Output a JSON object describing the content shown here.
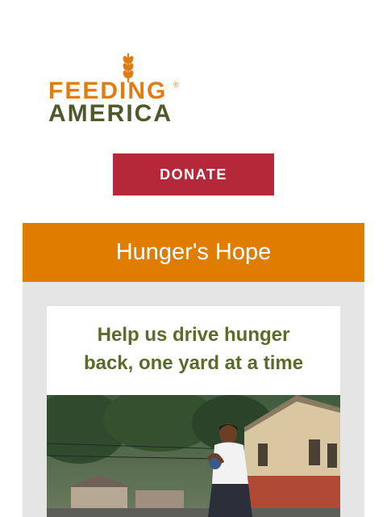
{
  "logo": {
    "line1": "FEEDING",
    "line2": "AMERICA",
    "registered_mark": "®",
    "colors": {
      "orange": "#e17c12",
      "olive": "#4c5a2a"
    }
  },
  "donate": {
    "label": "DONATE",
    "color": "#b5283a"
  },
  "banner": {
    "title": "Hunger's Hope",
    "color": "#e07c00"
  },
  "card": {
    "heading_line1": "Help us drive hunger",
    "heading_line2": "back, one yard at a time",
    "heading_color": "#5b6b2a"
  },
  "photo": {
    "icon": "football-kid-photo"
  }
}
